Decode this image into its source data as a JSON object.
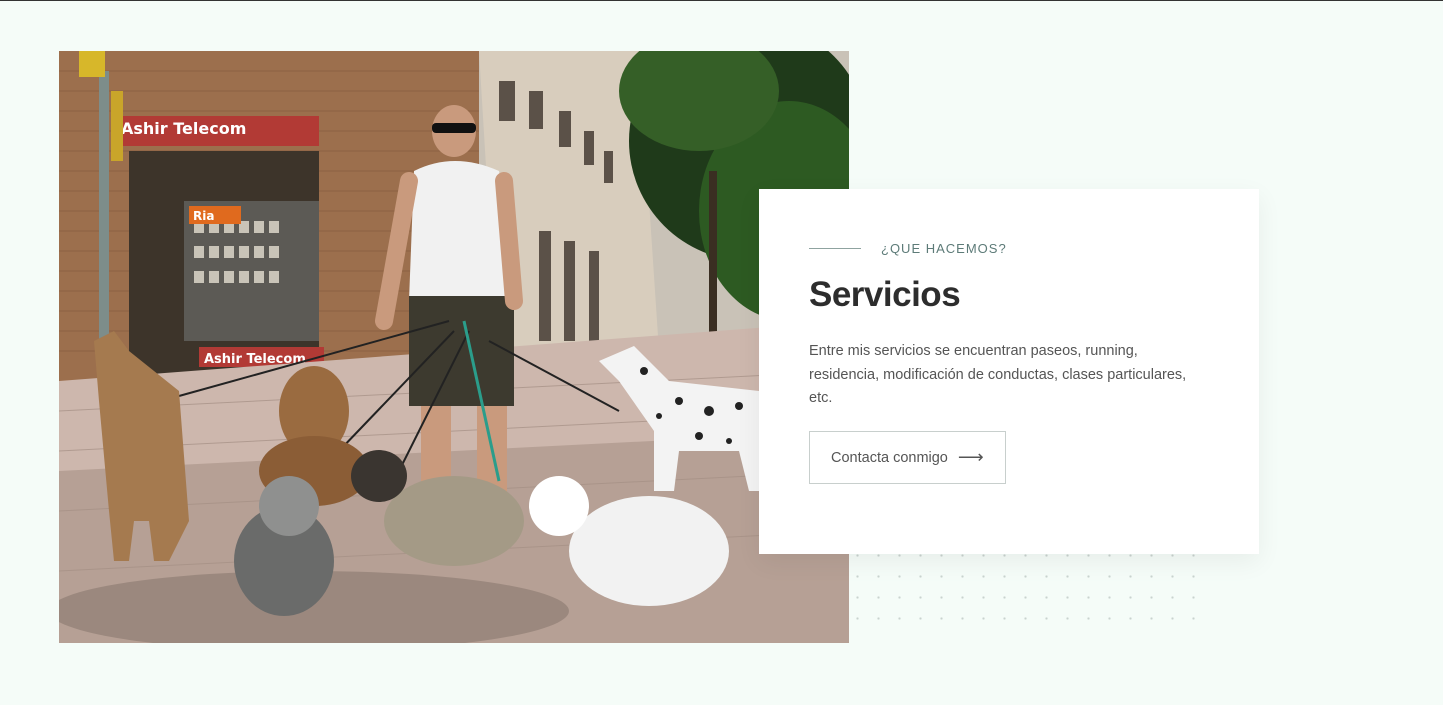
{
  "services": {
    "eyebrow": "¿QUE HACEMOS?",
    "title": "Servicios",
    "description": "Entre mis servicios se encuentran paseos, running, residencia, modificación de conductas, clases particulares, etc.",
    "cta_label": "Contacta conmigo",
    "cta_icon": "arrow-right-icon"
  },
  "photo": {
    "shop_sign": "Ashir Telecom",
    "shop_sign_lower": "Ashir Telecom",
    "shop_small_sign": "Ria"
  },
  "colors": {
    "page_background": "#f5fcf8",
    "card_background": "#ffffff",
    "title": "#2d2d2d",
    "eyebrow": "#5d7b78"
  }
}
